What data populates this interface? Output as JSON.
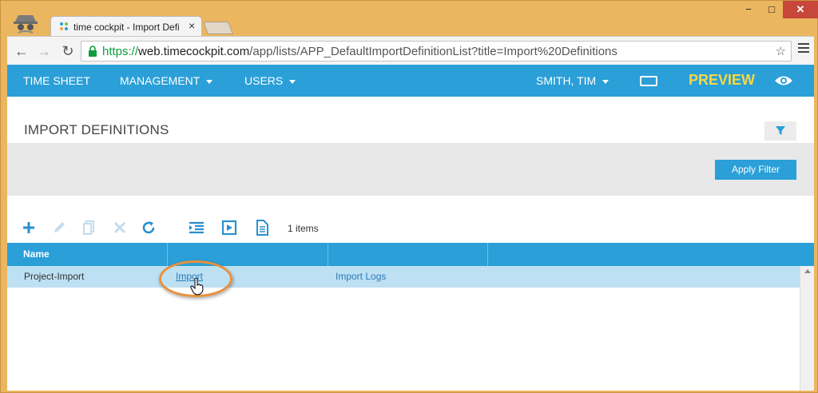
{
  "browser": {
    "tab_title": "time cockpit - Import Defi",
    "tab_close": "×",
    "window_min": "−",
    "window_max": "□",
    "window_close": "✕",
    "url_scheme": "https://",
    "url_host": "web.timecockpit.com",
    "url_path": "/app/lists/APP_DefaultImportDefinitionList?title=Import%20Definitions",
    "back": "←",
    "forward": "→",
    "reload": "↻",
    "omni_icons": "☆"
  },
  "nav": {
    "time_sheet": "TIME SHEET",
    "management": "MANAGEMENT",
    "users": "USERS",
    "user": "SMITH, TIM",
    "preview": "PREVIEW"
  },
  "page": {
    "title": "IMPORT DEFINITIONS",
    "apply_filter": "Apply Filter",
    "item_count": "1 items"
  },
  "grid": {
    "columns": [
      "Name",
      "",
      "",
      ""
    ],
    "rows": [
      {
        "name": "Project-Import",
        "action1": "Import",
        "action2": "Import Logs"
      }
    ]
  },
  "colors": {
    "brand_blue": "#2a9fd8",
    "preview_yellow": "#f5d843",
    "row_selected": "#bde0f3",
    "highlight_orange": "#e9903a"
  }
}
